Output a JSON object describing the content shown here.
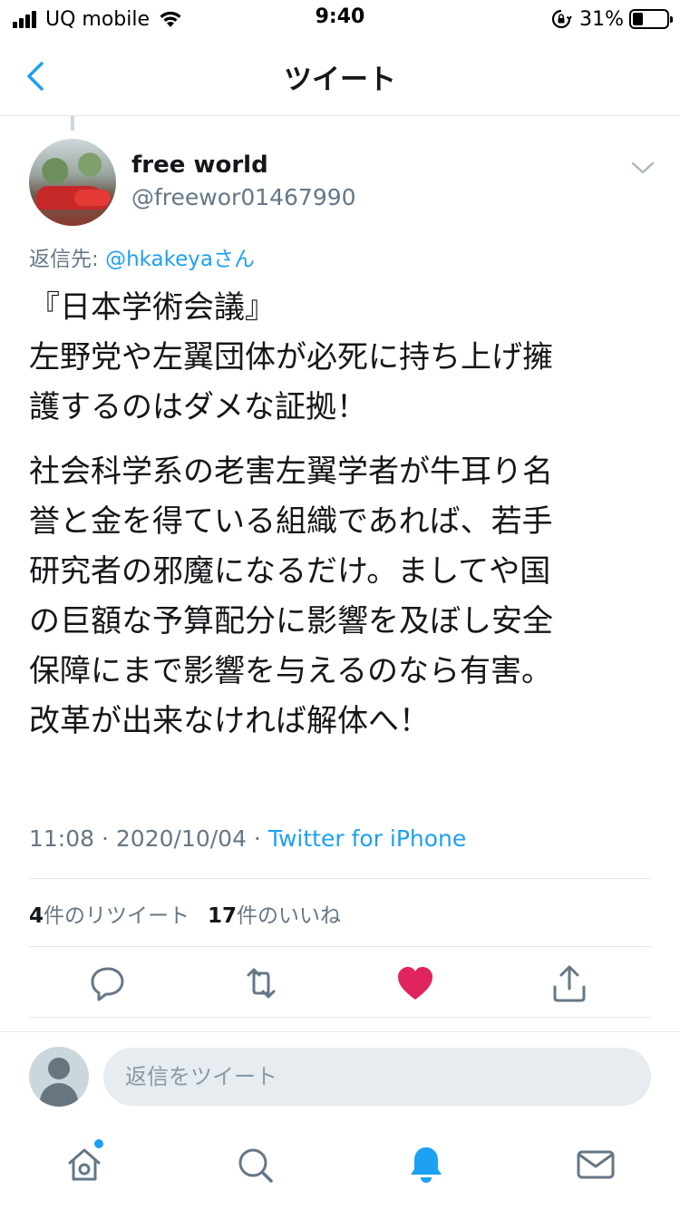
{
  "status_bar": {
    "carrier": "UQ mobile",
    "time": "9:40",
    "battery": "31%",
    "battery_level": 0.31
  },
  "nav": {
    "title": "ツイート",
    "back_icon": "chevron-left-icon"
  },
  "tweet": {
    "display_name": "free world",
    "handle": "@freewor01467990",
    "reply_to_prefix": "返信先: ",
    "reply_to_user": "@hkakeya",
    "reply_to_suffix": "さん",
    "text_para1_lines": [
      "『日本学術会議』",
      "左野党や左翼団体が必死に持ち上げ擁",
      "護するのはダメな証拠！"
    ],
    "text_para2_lines": [
      "社会科学系の老害左翼学者が牛耳り名",
      "誉と金を得ている組織であれば、若手",
      "研究者の邪魔になるだけ。ましてや国",
      "の巨額な予算配分に影響を及ぼし安全",
      "保障にまで影響を与えるのなら有害。",
      "改革が出来なければ解体へ！"
    ],
    "time": "11:08",
    "separator": " · ",
    "date": "2020/10/04",
    "source": "Twitter for iPhone",
    "retweet_count": "4",
    "retweet_label": "件のリツイート",
    "like_count": "17",
    "like_label": "件のいいね",
    "liked": true,
    "colors": {
      "accent": "#1da1f2",
      "like": "#e0245e",
      "muted": "#657786"
    }
  },
  "actions": [
    "reply-icon",
    "retweet-icon",
    "like-icon",
    "share-icon"
  ],
  "reply_composer": {
    "placeholder": "返信をツイート"
  },
  "tab_bar": [
    "home-icon",
    "search-icon",
    "notifications-icon",
    "messages-icon"
  ]
}
